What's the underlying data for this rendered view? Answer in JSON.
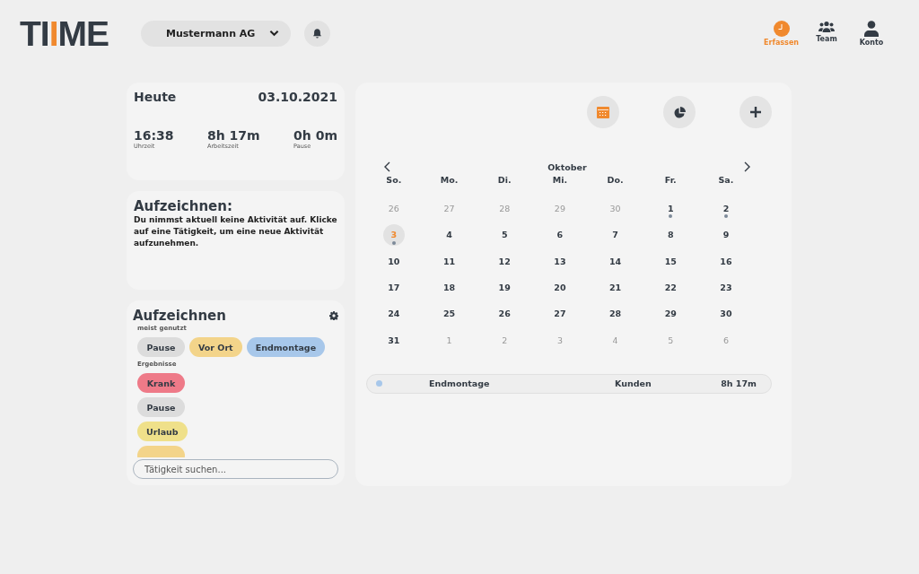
{
  "logo": {
    "parts": [
      {
        "text": "TI",
        "accent": false
      },
      {
        "text": "I",
        "accent": true
      },
      {
        "text": "ME",
        "accent": false
      }
    ]
  },
  "company_select": {
    "value": "Mustermann AG"
  },
  "nav": [
    {
      "label": "Erfassen",
      "selected": true
    },
    {
      "label": "Team",
      "selected": false
    },
    {
      "label": "Konto",
      "selected": false
    }
  ],
  "today": {
    "title": "Heute",
    "date": "03.10.2021",
    "stats": [
      {
        "value": "16:38",
        "label": "Uhrzeit"
      },
      {
        "value": "8h 17m",
        "label": "Arbeitszeit"
      },
      {
        "value": "0h 0m",
        "label": "Pause"
      }
    ]
  },
  "recording": {
    "title": "Aufzeichnen:",
    "message": "Du nimmst aktuell keine Aktivität auf. Klicke auf eine Tätigkeit, um eine neue Aktivität aufzunehmen."
  },
  "activities": {
    "title": "Aufzeichnen",
    "groups": [
      {
        "label": "meist genutzt",
        "items": [
          {
            "label": "Pause",
            "color": "#dcdcdc"
          },
          {
            "label": "Vor Ort",
            "color": "#f3d48a"
          },
          {
            "label": "Endmontage",
            "color": "#a7c7ea"
          }
        ]
      },
      {
        "label": "Ergebnisse",
        "items": [
          {
            "label": "Krank",
            "color": "#ee7a88"
          },
          {
            "label": "Pause",
            "color": "#dcdcdc"
          },
          {
            "label": "Urlaub",
            "color": "#efe08a"
          },
          {
            "color": "#f3d48a"
          }
        ]
      }
    ],
    "search": {
      "placeholder": "Tätigkeit suchen..."
    }
  },
  "calendar": {
    "view_buttons": [
      {
        "selected": true
      },
      {
        "selected": false
      },
      {
        "selected": false
      }
    ],
    "month": "Oktober",
    "weekdays": [
      "So.",
      "Mo.",
      "Di.",
      "Mi.",
      "Do.",
      "Fr.",
      "Sa."
    ],
    "weeks": [
      [
        {
          "day": "26",
          "in_month": false,
          "selected": false,
          "has_entry": false
        },
        {
          "day": "27",
          "in_month": false,
          "selected": false,
          "has_entry": false
        },
        {
          "day": "28",
          "in_month": false,
          "selected": false,
          "has_entry": false
        },
        {
          "day": "29",
          "in_month": false,
          "selected": false,
          "has_entry": false
        },
        {
          "day": "30",
          "in_month": false,
          "selected": false,
          "has_entry": false
        },
        {
          "day": "1",
          "in_month": true,
          "selected": false,
          "has_entry": true
        },
        {
          "day": "2",
          "in_month": true,
          "selected": false,
          "has_entry": true
        }
      ],
      [
        {
          "day": "3",
          "in_month": true,
          "selected": true,
          "has_entry": true
        },
        {
          "day": "4",
          "in_month": true,
          "selected": false,
          "has_entry": false
        },
        {
          "day": "5",
          "in_month": true,
          "selected": false,
          "has_entry": false
        },
        {
          "day": "6",
          "in_month": true,
          "selected": false,
          "has_entry": false
        },
        {
          "day": "7",
          "in_month": true,
          "selected": false,
          "has_entry": false
        },
        {
          "day": "8",
          "in_month": true,
          "selected": false,
          "has_entry": false
        },
        {
          "day": "9",
          "in_month": true,
          "selected": false,
          "has_entry": false
        }
      ],
      [
        {
          "day": "10",
          "in_month": true,
          "selected": false,
          "has_entry": false
        },
        {
          "day": "11",
          "in_month": true,
          "selected": false,
          "has_entry": false
        },
        {
          "day": "12",
          "in_month": true,
          "selected": false,
          "has_entry": false
        },
        {
          "day": "13",
          "in_month": true,
          "selected": false,
          "has_entry": false
        },
        {
          "day": "14",
          "in_month": true,
          "selected": false,
          "has_entry": false
        },
        {
          "day": "15",
          "in_month": true,
          "selected": false,
          "has_entry": false
        },
        {
          "day": "16",
          "in_month": true,
          "selected": false,
          "has_entry": false
        }
      ],
      [
        {
          "day": "17",
          "in_month": true,
          "selected": false,
          "has_entry": false
        },
        {
          "day": "18",
          "in_month": true,
          "selected": false,
          "has_entry": false
        },
        {
          "day": "19",
          "in_month": true,
          "selected": false,
          "has_entry": false
        },
        {
          "day": "20",
          "in_month": true,
          "selected": false,
          "has_entry": false
        },
        {
          "day": "21",
          "in_month": true,
          "selected": false,
          "has_entry": false
        },
        {
          "day": "22",
          "in_month": true,
          "selected": false,
          "has_entry": false
        },
        {
          "day": "23",
          "in_month": true,
          "selected": false,
          "has_entry": false
        }
      ],
      [
        {
          "day": "24",
          "in_month": true,
          "selected": false,
          "has_entry": false
        },
        {
          "day": "25",
          "in_month": true,
          "selected": false,
          "has_entry": false
        },
        {
          "day": "26",
          "in_month": true,
          "selected": false,
          "has_entry": false
        },
        {
          "day": "27",
          "in_month": true,
          "selected": false,
          "has_entry": false
        },
        {
          "day": "28",
          "in_month": true,
          "selected": false,
          "has_entry": false
        },
        {
          "day": "29",
          "in_month": true,
          "selected": false,
          "has_entry": false
        },
        {
          "day": "30",
          "in_month": true,
          "selected": false,
          "has_entry": false
        }
      ],
      [
        {
          "day": "31",
          "in_month": true,
          "selected": false,
          "has_entry": false
        },
        {
          "day": "1",
          "in_month": false,
          "selected": false,
          "has_entry": false
        },
        {
          "day": "2",
          "in_month": false,
          "selected": false,
          "has_entry": false
        },
        {
          "day": "3",
          "in_month": false,
          "selected": false,
          "has_entry": false
        },
        {
          "day": "4",
          "in_month": false,
          "selected": false,
          "has_entry": false
        },
        {
          "day": "5",
          "in_month": false,
          "selected": false,
          "has_entry": false
        },
        {
          "day": "6",
          "in_month": false,
          "selected": false,
          "has_entry": false
        }
      ]
    ],
    "entries": [
      {
        "activity": "Endmontage",
        "category": "Kunden",
        "duration": "8h 17m",
        "color": "#a7c7ea"
      }
    ]
  }
}
